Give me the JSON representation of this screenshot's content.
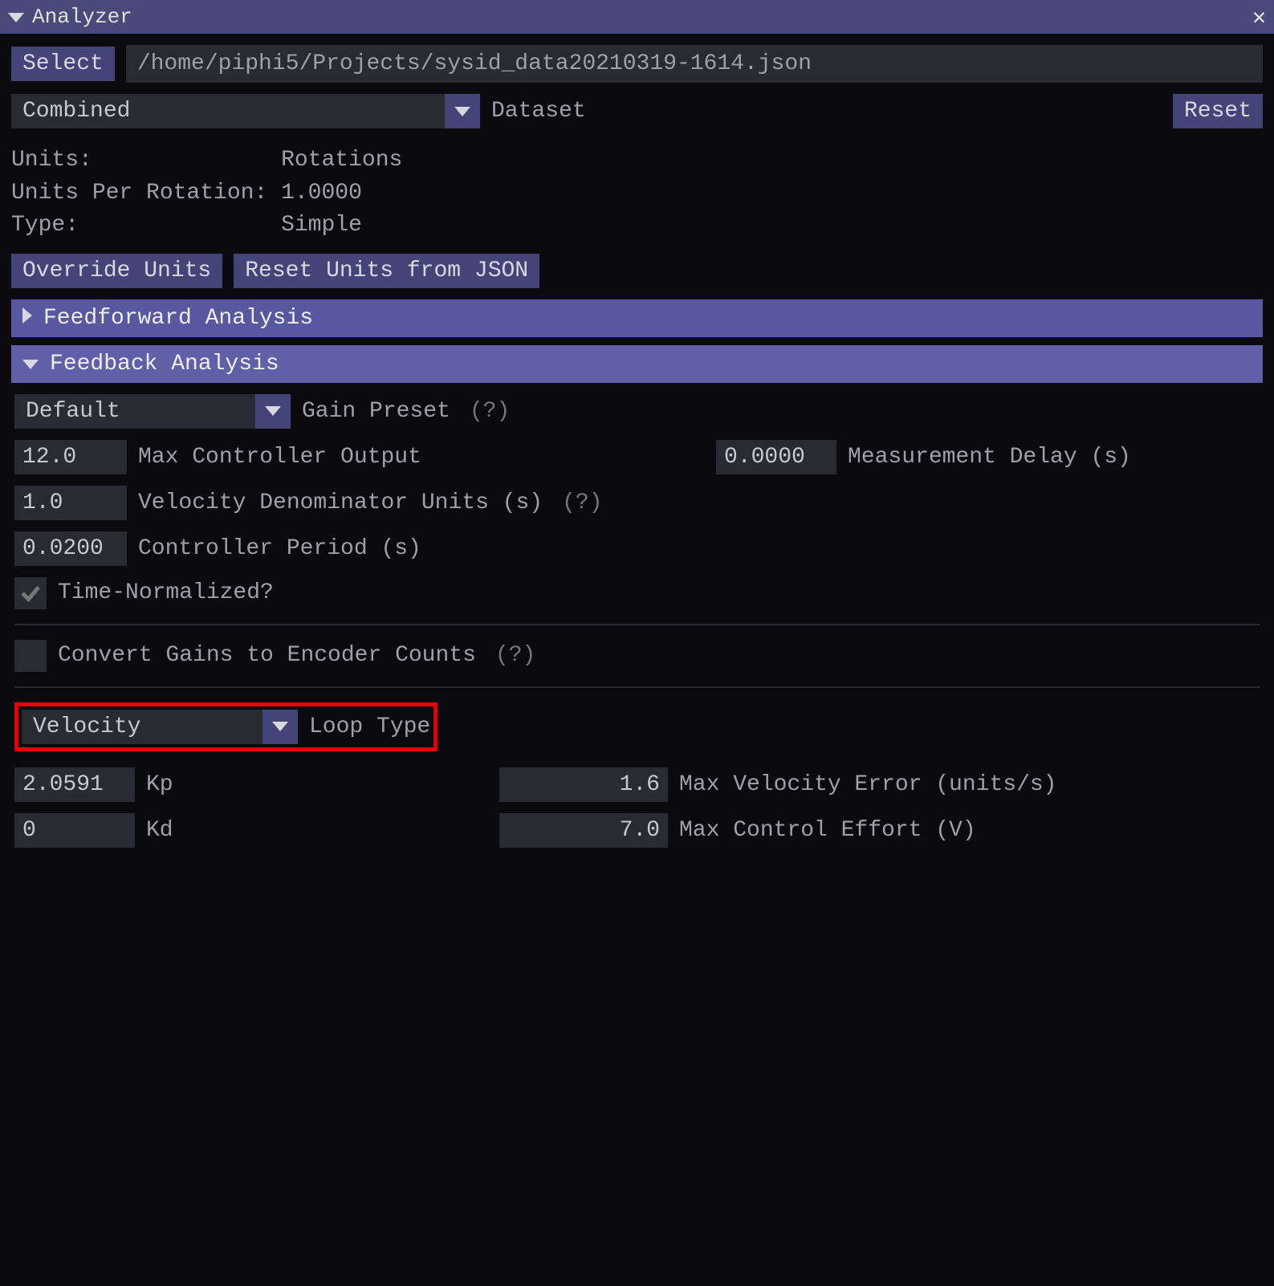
{
  "titlebar": {
    "title": "Analyzer"
  },
  "file": {
    "select_label": "Select",
    "path": "/home/piphi5/Projects/sysid_data20210319-1614.json"
  },
  "dataset": {
    "combo_value": "Combined",
    "label": "Dataset",
    "reset_label": "Reset"
  },
  "info": {
    "units_label": "Units:",
    "units_value": "Rotations",
    "upr_label": "Units Per Rotation:",
    "upr_value": "1.0000",
    "type_label": "Type:",
    "type_value": "Simple"
  },
  "buttons": {
    "override_units": "Override Units",
    "reset_units_json": "Reset Units from JSON"
  },
  "sections": {
    "feedforward": "Feedforward Analysis",
    "feedback": "Feedback Analysis"
  },
  "feedback": {
    "gain_preset_value": "Default",
    "gain_preset_label": "Gain Preset",
    "q": "(?)",
    "max_ctrl_out_value": "12.0",
    "max_ctrl_out_label": "Max Controller Output",
    "meas_delay_value": "0.0000",
    "meas_delay_label": "Measurement Delay (s)",
    "vel_denom_value": "1.0",
    "vel_denom_label": "Velocity Denominator Units (s)",
    "ctrl_period_value": "0.0200",
    "ctrl_period_label": "Controller Period (s)",
    "time_norm_label": "Time-Normalized?",
    "convert_gains_label": "Convert Gains to Encoder Counts",
    "loop_type_value": "Velocity",
    "loop_type_label": "Loop Type",
    "kp_value": "2.0591",
    "kp_label": "Kp",
    "kd_value": "0",
    "kd_label": "Kd",
    "max_vel_err_value": "1.6",
    "max_vel_err_label": "Max Velocity Error (units/s)",
    "max_ctrl_eff_value": "7.0",
    "max_ctrl_eff_label": "Max Control Effort (V)"
  }
}
